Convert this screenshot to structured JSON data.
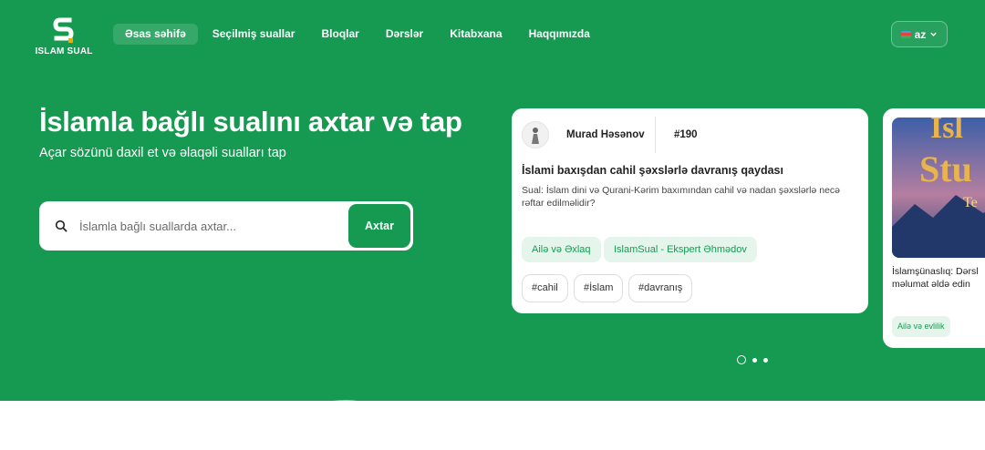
{
  "brand": {
    "logo_letter": "S",
    "name": "ISLAM SUAL"
  },
  "nav": {
    "items": [
      {
        "label": "Əsas səhifə",
        "active": true
      },
      {
        "label": "Seçilmiş suallar"
      },
      {
        "label": "Bloqlar"
      },
      {
        "label": "Dərslər"
      },
      {
        "label": "Kitabxana"
      },
      {
        "label": "Haqqımızda"
      }
    ]
  },
  "language": {
    "selected": "az",
    "icon": "flag-icon"
  },
  "hero": {
    "title": "İslamla bağlı sualını axtar və tap",
    "subtitle": "Açar sözünü daxil et və əlaqəli sualları tap"
  },
  "search": {
    "placeholder": "İslamla bağlı suallarda axtar...",
    "button_label": "Axtar",
    "icon": "search-icon"
  },
  "question_card": {
    "author": "Murad Həsənov",
    "number": "#190",
    "title": "İslami baxışdan cahil şəxslərlə davranış qaydası",
    "text": "Sual: İslam dini və Qurani-Kərim baxımından cahil və nadan şəxslərlə necə rəftar edilməlidir?",
    "categories": [
      "Ailə və Əxlaq",
      "IslamSual - Ekspert Əhmədov"
    ],
    "tags": [
      "#cahil",
      "#İslam",
      "#davranış"
    ]
  },
  "second_card": {
    "text_line1": "İslamşünaslıq: Dərsl",
    "text_line2": "məlumat əldə edin",
    "chip": "Ailə və evlilik"
  },
  "carousel": {
    "total": 3,
    "active": 1
  },
  "colors": {
    "primary": "#169a52",
    "chip_bg": "#e6f5ec"
  }
}
